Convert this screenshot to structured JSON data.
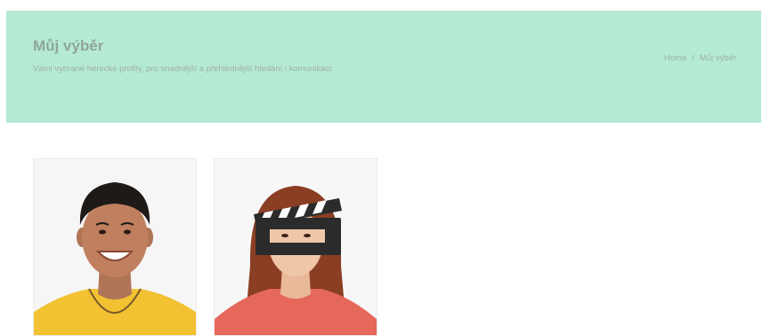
{
  "header": {
    "title": "Můj výběr",
    "subtitle": "Vámi vybrané herecké profily, pro snadnější a přehlednější hledání i komunikaci."
  },
  "breadcrumb": {
    "home": "Home",
    "separator": "/",
    "current": "Můj výběr"
  },
  "profiles": [
    {
      "photo": "actor-man-yellow-shirt"
    },
    {
      "photo": "actress-woman-red-shirt",
      "overlay_icon": "clapperboard-icon"
    }
  ],
  "colors": {
    "hero_background": "#b5ead3",
    "title": "#8ea69b"
  }
}
